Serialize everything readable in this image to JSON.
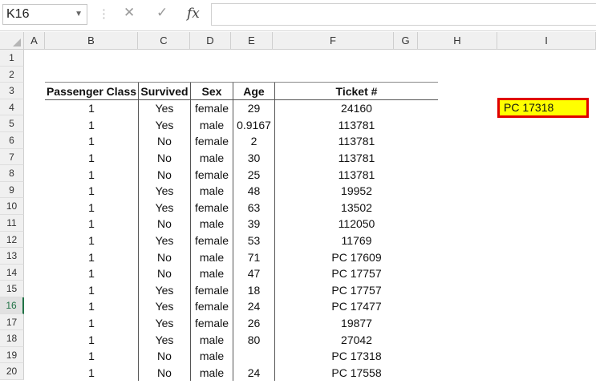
{
  "formula_bar": {
    "name_box": "K16",
    "cancel_glyph": "✕",
    "enter_glyph": "✓",
    "fx_label": "fx",
    "formula": ""
  },
  "columns": [
    "A",
    "B",
    "C",
    "D",
    "E",
    "F",
    "G",
    "H",
    "I"
  ],
  "rows": [
    "1",
    "2",
    "3",
    "4",
    "5",
    "6",
    "7",
    "8",
    "9",
    "10",
    "11",
    "12",
    "13",
    "14",
    "15",
    "16",
    "17",
    "18",
    "19",
    "20"
  ],
  "active_row": "16",
  "table": {
    "headers": [
      "Passenger Class",
      "Survived",
      "Sex",
      "Age",
      "Ticket #"
    ],
    "rows": [
      [
        "1",
        "Yes",
        "female",
        "29",
        "24160"
      ],
      [
        "1",
        "Yes",
        "male",
        "0.9167",
        "113781"
      ],
      [
        "1",
        "No",
        "female",
        "2",
        "113781"
      ],
      [
        "1",
        "No",
        "male",
        "30",
        "113781"
      ],
      [
        "1",
        "No",
        "female",
        "25",
        "113781"
      ],
      [
        "1",
        "Yes",
        "male",
        "48",
        "19952"
      ],
      [
        "1",
        "Yes",
        "female",
        "63",
        "13502"
      ],
      [
        "1",
        "No",
        "male",
        "39",
        "112050"
      ],
      [
        "1",
        "Yes",
        "female",
        "53",
        "11769"
      ],
      [
        "1",
        "No",
        "male",
        "71",
        "PC 17609"
      ],
      [
        "1",
        "No",
        "male",
        "47",
        "PC 17757"
      ],
      [
        "1",
        "Yes",
        "female",
        "18",
        "PC 17757"
      ],
      [
        "1",
        "Yes",
        "female",
        "24",
        "PC 17477"
      ],
      [
        "1",
        "Yes",
        "female",
        "26",
        "19877"
      ],
      [
        "1",
        "Yes",
        "male",
        "80",
        "27042"
      ],
      [
        "1",
        "No",
        "male",
        "",
        "PC 17318"
      ],
      [
        "1",
        "No",
        "male",
        "24",
        "PC 17558"
      ]
    ]
  },
  "highlight_cell": {
    "value": "PC 17318",
    "fill": "#ffff00",
    "border": "#e00000"
  },
  "colors": {
    "accent": "#217346"
  }
}
